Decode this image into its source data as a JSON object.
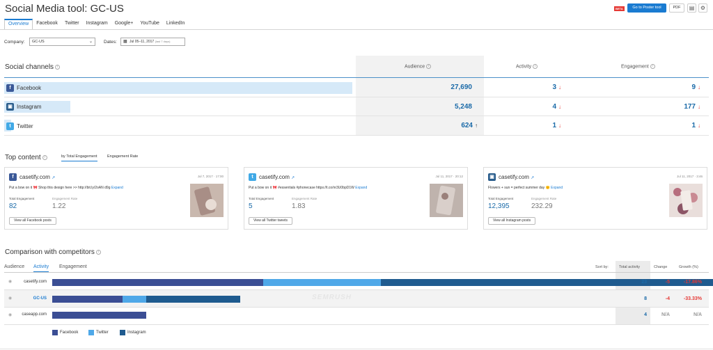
{
  "header": {
    "title": "Social Media tool: GC-US",
    "beta": "BETA",
    "poster_button": "Go to Poster tool",
    "pdf_button": "PDF",
    "doc_icon": "document-icon",
    "gear_icon": "gear-icon"
  },
  "tabs": [
    "Overview",
    "Facebook",
    "Twitter",
    "Instagram",
    "Google+",
    "YouTube",
    "LinkedIn"
  ],
  "filters": {
    "company_label": "Company:",
    "company_value": "GC-US",
    "dates_label": "Dates:",
    "dates_value": "Jul 05–11, 2017",
    "dates_note": "(last 7 days)"
  },
  "social": {
    "title": "Social channels",
    "columns": {
      "audience": "Audience",
      "activity": "Activity",
      "engagement": "Engagement"
    },
    "colors": {
      "facebook": "#3b5998",
      "instagram": "#2a5d8c",
      "twitter": "#41a9e6"
    },
    "rows": [
      {
        "name": "Facebook",
        "icon": "facebook-icon",
        "audience": "27,690",
        "audience_share": 1.0,
        "activity": "3",
        "engagement": "9"
      },
      {
        "name": "Instagram",
        "icon": "instagram-icon",
        "audience": "5,248",
        "audience_share": 0.19,
        "activity": "4",
        "engagement": "177"
      },
      {
        "name": "Twitter",
        "icon": "twitter-icon",
        "audience": "624",
        "audience_share": 0.02,
        "activity": "1",
        "engagement": "1"
      }
    ]
  },
  "top_content": {
    "title": "Top content",
    "tabs": [
      "by Total Engagement",
      "Engagement Rate"
    ],
    "cards": [
      {
        "network": "facebook",
        "account": "casetify.com",
        "date": "Jul 7, 2017 · 17:00",
        "text": "Put a bow on it 🎀 Shop this design here >> http://bit.ly/2oAN d9g",
        "expand": "Expand",
        "metric1_label": "Total Engagement",
        "metric1_value": "82",
        "metric2_label": "Engagement Rate",
        "metric2_value": "1.22",
        "view_all": "View all Facebook posts"
      },
      {
        "network": "twitter",
        "account": "casetify.com",
        "date": "Jul 11, 2017 · 20:12",
        "text": "Put a bow on it 🎀 #essentials #phonecase https://t.co/nr3U0bpD1W",
        "expand": "Expand",
        "metric1_label": "Total Engagement",
        "metric1_value": "5",
        "metric2_label": "Engagement Rate",
        "metric2_value": "1.83",
        "view_all": "View all Twitter tweets"
      },
      {
        "network": "instagram",
        "account": "casetify.com",
        "date": "Jul 11, 2017 · 3:46",
        "text": "Flowers + sun = perfect summer day 🌞",
        "expand": "Expand",
        "metric1_label": "Total Engagement",
        "metric1_value": "12,395",
        "metric2_label": "Engagement Rate",
        "metric2_value": "232.29",
        "view_all": "View all Instagram posts"
      }
    ]
  },
  "comparison": {
    "title": "Comparison with competitors",
    "tabs": [
      "Audience",
      "Activity",
      "Engagement"
    ],
    "sort_by": "Sort by:",
    "columns": {
      "total_activity": "Total activity",
      "change": "Change",
      "growth": "Growth (%)"
    },
    "max_total": 23,
    "rows": [
      {
        "domain": "casetify.com",
        "self": false,
        "facebook": 9,
        "twitter": 5,
        "instagram": 15,
        "total": "23",
        "change": "-5",
        "growth": "-17.86%",
        "negative": true
      },
      {
        "domain": "GC-US",
        "self": true,
        "facebook": 3,
        "twitter": 1,
        "instagram": 4,
        "total": "8",
        "change": "-4",
        "growth": "-33.33%",
        "negative": true
      },
      {
        "domain": "caseapp.com",
        "self": false,
        "facebook": 4,
        "twitter": 0,
        "instagram": 0,
        "total": "4",
        "change": "N/A",
        "growth": "N/A",
        "negative": false
      }
    ],
    "legend": [
      {
        "name": "Facebook",
        "color": "#3b4e94"
      },
      {
        "name": "Twitter",
        "color": "#4fa8e8"
      },
      {
        "name": "Instagram",
        "color": "#1f5b8f"
      }
    ],
    "watermark": "SEMRUSH"
  }
}
